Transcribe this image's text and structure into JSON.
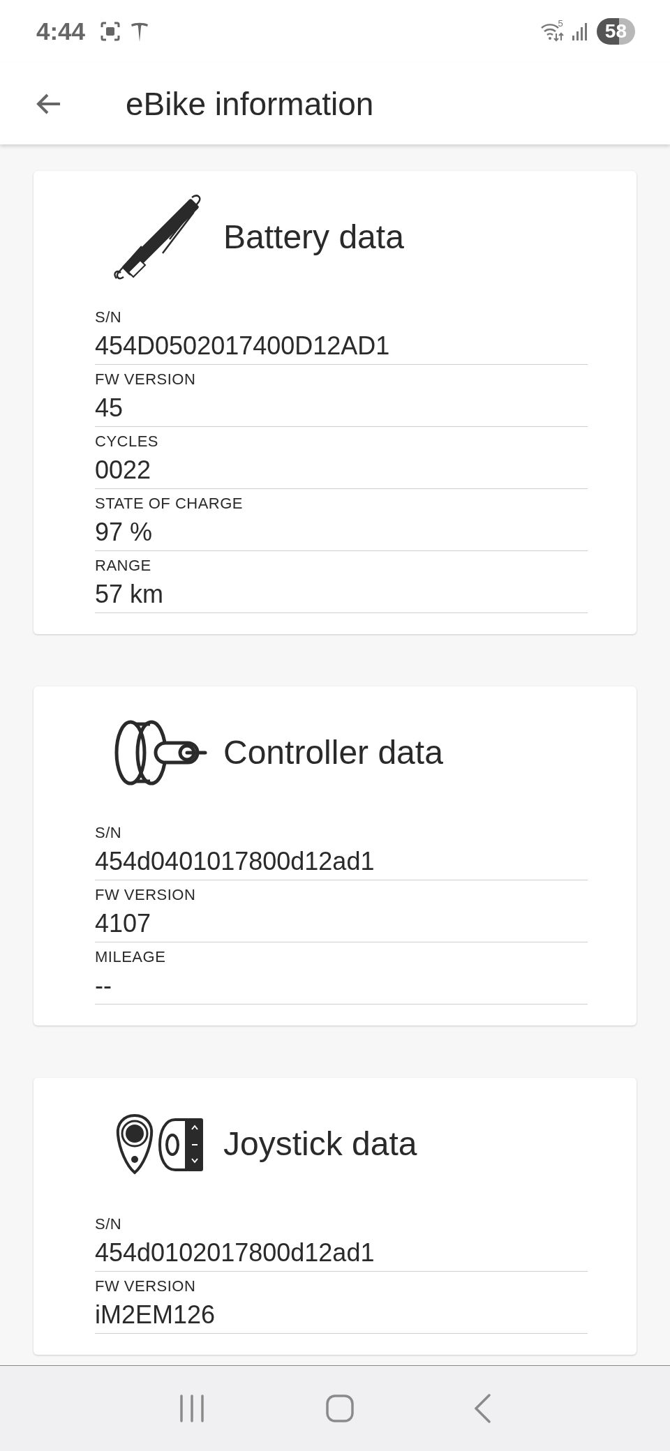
{
  "status_bar": {
    "time": "4:44",
    "network_label": "5",
    "battery": "58"
  },
  "app_bar": {
    "title": "eBike information"
  },
  "cards": [
    {
      "kind": "battery",
      "title": "Battery data",
      "fields": [
        {
          "label": "S/N",
          "value": "454D0502017400D12AD1"
        },
        {
          "label": "FW VERSION",
          "value": "45"
        },
        {
          "label": "CYCLES",
          "value": "0022"
        },
        {
          "label": "STATE OF CHARGE",
          "value": "97 %"
        },
        {
          "label": "RANGE",
          "value": "57 km"
        }
      ]
    },
    {
      "kind": "controller",
      "title": "Controller data",
      "fields": [
        {
          "label": "S/N",
          "value": "454d0401017800d12ad1"
        },
        {
          "label": "FW VERSION",
          "value": "4107"
        },
        {
          "label": "MILEAGE",
          "value": "--"
        }
      ]
    },
    {
      "kind": "joystick",
      "title": "Joystick data",
      "fields": [
        {
          "label": "S/N",
          "value": "454d0102017800d12ad1"
        },
        {
          "label": "FW VERSION",
          "value": "iM2EM126"
        }
      ]
    }
  ]
}
